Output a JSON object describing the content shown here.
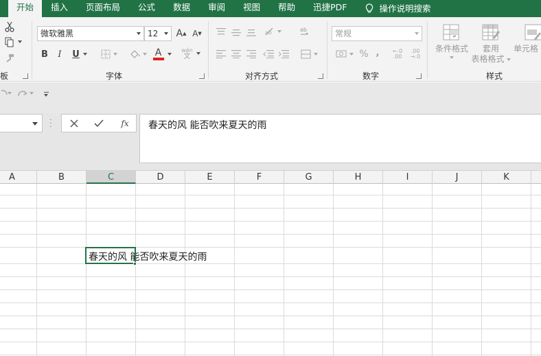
{
  "tabs": {
    "items": [
      "开始",
      "插入",
      "页面布局",
      "公式",
      "数据",
      "审阅",
      "视图",
      "帮助",
      "迅捷PDF"
    ],
    "search_label": "操作说明搜索"
  },
  "ribbon": {
    "clipboard_label": "板",
    "font": {
      "label": "字体",
      "name": "微软雅黑",
      "size": "12",
      "bold": "B",
      "italic": "I",
      "underline": "U",
      "grow": "A",
      "shrink": "A",
      "color_glyph": "A",
      "phonetic": "wén"
    },
    "alignment": {
      "label": "对齐方式"
    },
    "number": {
      "label": "数字",
      "format": "常规",
      "percent": "%",
      "comma": ",",
      "inc_decimal": "←.0\n.00",
      "dec_decimal": ".00\n→.0"
    },
    "styles": {
      "label": "样式",
      "conditional": "条件格式",
      "table_line1": "套用",
      "table_line2": "表格格式",
      "cell_styles": "单元格"
    }
  },
  "formula_bar": {
    "content": "春天的风 能否吹来夏天的雨",
    "fx": "fx"
  },
  "grid": {
    "columns": [
      "A",
      "B",
      "C",
      "D",
      "E",
      "F",
      "G",
      "H",
      "I",
      "J",
      "K"
    ],
    "selected_column": "C",
    "cell_c_value": "春天的风 能否吹来夏天的雨"
  },
  "colors": {
    "accent": "#217346",
    "font_color_bar": "#e02020"
  }
}
